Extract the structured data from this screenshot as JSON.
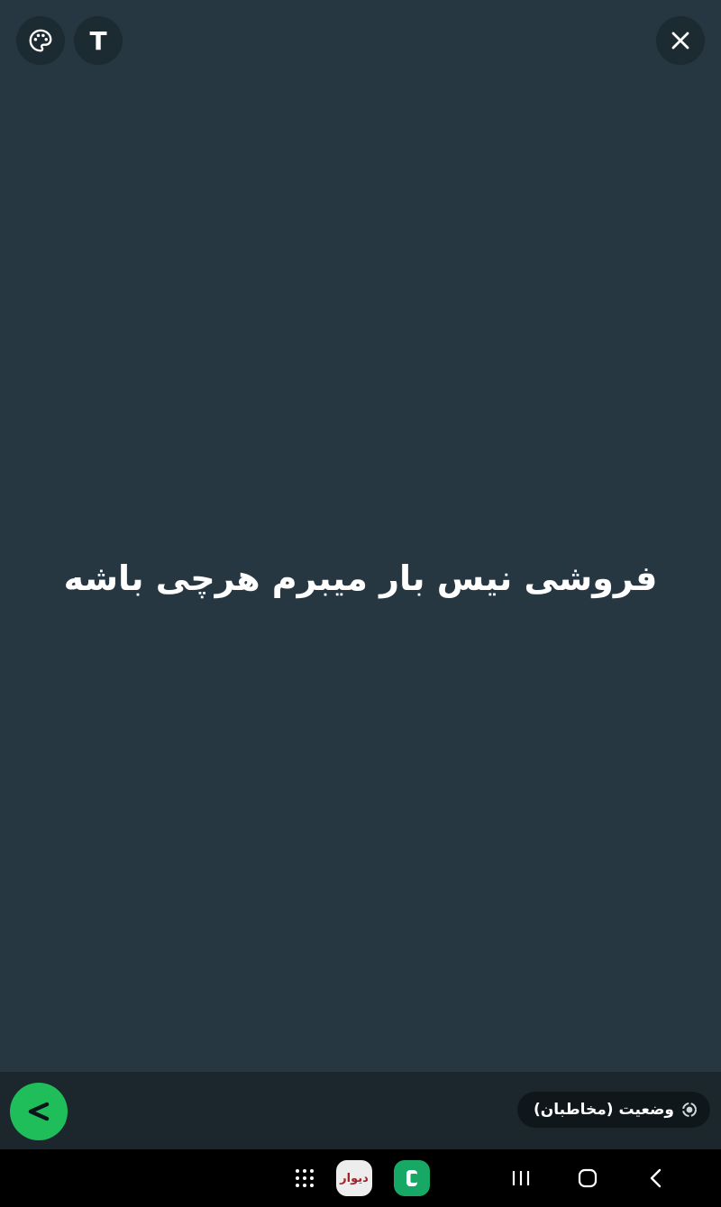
{
  "editor": {
    "status_text": "فروشی نیس بار میبرم هرچی باشه",
    "background_color": "#263741",
    "toolbar": {
      "palette_icon": "palette-icon",
      "text_tool_label": "T",
      "close_icon": "close-icon"
    }
  },
  "bottom_bar": {
    "send_icon": "send-icon",
    "send_color": "#1fbe5a",
    "privacy_label": "وضعیت (مخاطبان)",
    "privacy_icon": "status-ring-icon"
  },
  "system_nav": {
    "dock_apps": [
      {
        "name": "app-drawer",
        "icon": "grid-icon"
      },
      {
        "name": "divar",
        "label": "دیوار"
      },
      {
        "name": "phone-app",
        "icon": "phone-icon"
      }
    ],
    "buttons": [
      "recent-apps-icon",
      "home-icon",
      "back-icon"
    ]
  }
}
